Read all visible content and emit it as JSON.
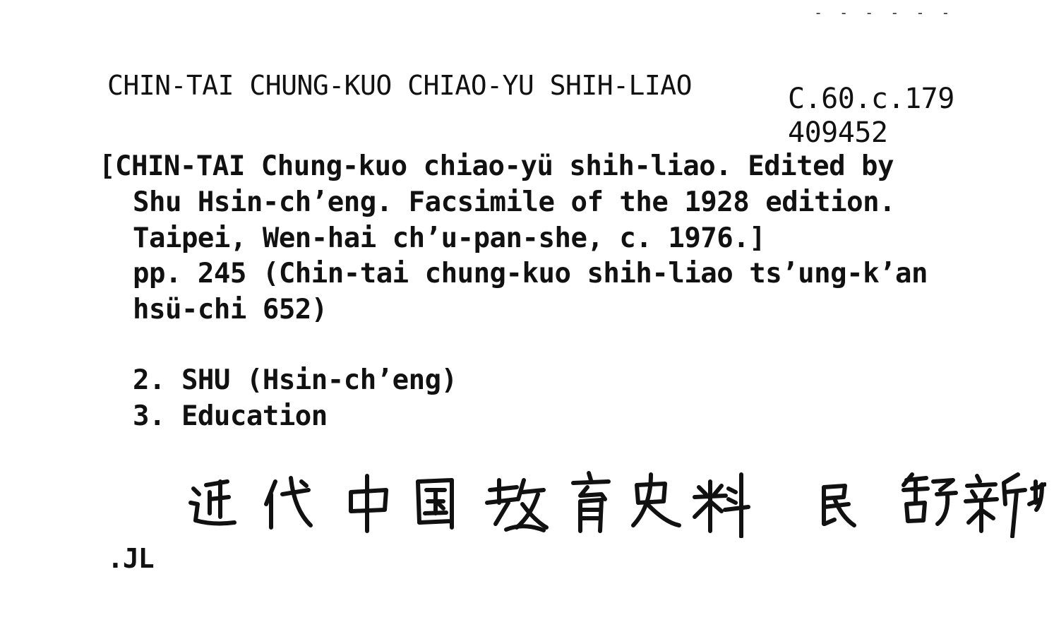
{
  "heading": "CHIN-TAI CHUNG-KUO CHIAO-YU SHIH-LIAO",
  "shelfmark": {
    "line1": "C.60.c.179",
    "line2": "409452"
  },
  "entry": {
    "line1": "[CHIN-TAI Chung-kuo chiao-yü shih-liao. Edited by",
    "line2": "Shu Hsin-ch’eng. Facsimile of the 1928 edition.",
    "line3": "Taipei, Wen-hai ch’u-pan-she, c. 1976.]",
    "line4": "pp. 245 (Chin-tai chung-kuo shih-liao ts’ung-k’an",
    "line5": "hsü-chi 652)"
  },
  "tracings": {
    "item2": "2. SHU (Hsin-ch’eng)",
    "item3": "3. Education"
  },
  "handwritten_title": "近代中国教育史料 民 舒新城",
  "initials": ".JL",
  "top_dashes": "- - - - - -"
}
